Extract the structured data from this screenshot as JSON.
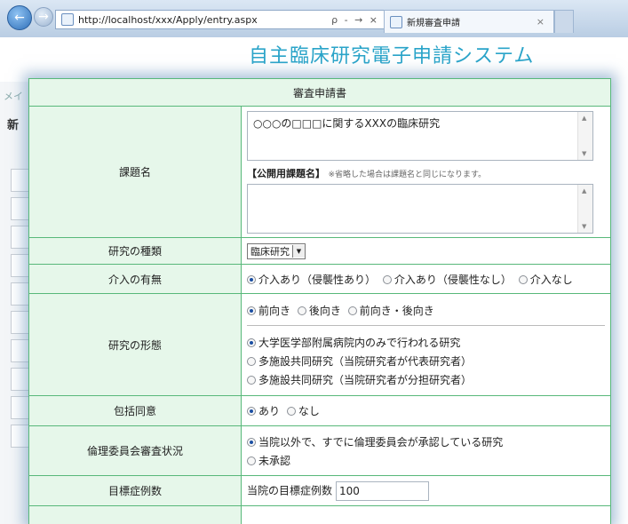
{
  "browser": {
    "url": "http://localhost/xxx/Apply/entry.aspx",
    "tools": "ρ - → ×",
    "tab_title": "新規審査申請",
    "tab_close": "×"
  },
  "app": {
    "title": "自主臨床研究電子申請システム",
    "left_menu_peek": "メイ",
    "left_new_peek": "新"
  },
  "dialog": {
    "title": "審査申請書",
    "fields": {
      "subject": {
        "label": "課題名",
        "value": "○○○の□□□に関するXXXの臨床研究",
        "public_label": "【公開用課題名】",
        "public_note": "※省略した場合は課題名と同じになります。",
        "public_value": ""
      },
      "type": {
        "label": "研究の種類",
        "value": "臨床研究"
      },
      "intervention": {
        "label": "介入の有無",
        "options": [
          "介入あり（侵襲性あり）",
          "介入あり（侵襲性なし）",
          "介入なし"
        ],
        "selected": 0
      },
      "form": {
        "label": "研究の形態",
        "direction_options": [
          "前向き",
          "後向き",
          "前向き・後向き"
        ],
        "direction_selected": 0,
        "site_options": [
          "大学医学部附属病院内のみで行われる研究",
          "多施設共同研究（当院研究者が代表研究者）",
          "多施設共同研究（当院研究者が分担研究者）"
        ],
        "site_selected": 0
      },
      "consent": {
        "label": "包括同意",
        "options": [
          "あり",
          "なし"
        ],
        "selected": 0
      },
      "ethics": {
        "label": "倫理委員会審査状況",
        "options": [
          "当院以外で、すでに倫理委員会が承認している研究",
          "未承認"
        ],
        "selected": 0
      },
      "target": {
        "label": "目標症例数",
        "prefix": "当院の目標症例数",
        "value": "100"
      }
    }
  }
}
